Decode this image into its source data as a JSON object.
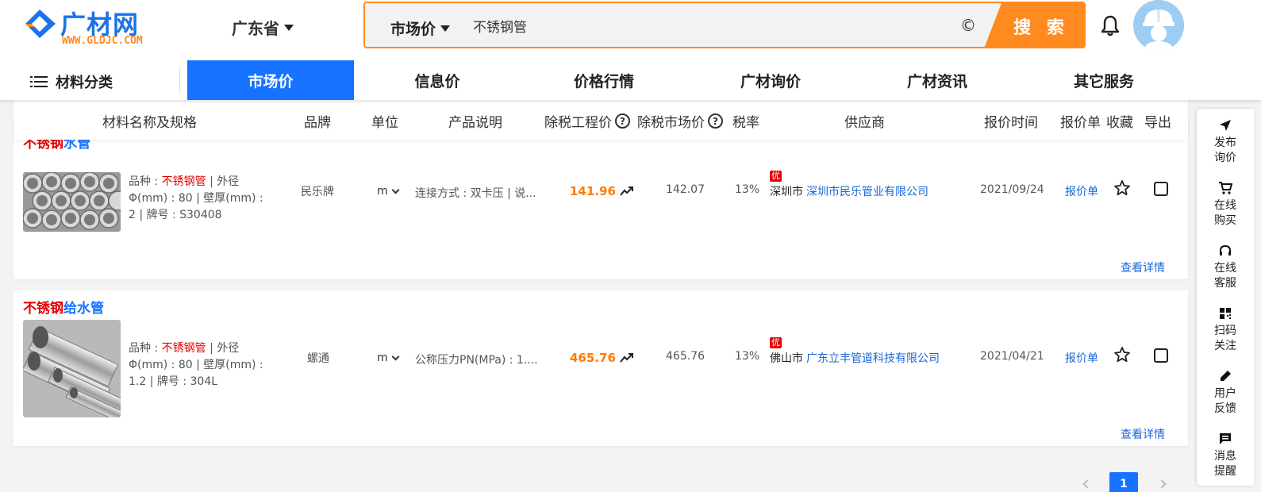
{
  "header": {
    "logo_title": "广材网",
    "logo_sub": "WWW.GLDJC.COM",
    "province": "广东省",
    "search": {
      "type": "市场价",
      "value": "不锈钢管",
      "button": "搜 索",
      "icon": "copyright-icon"
    }
  },
  "nav": {
    "category_label": "材料分类",
    "items": [
      {
        "label": "市场价",
        "active": true
      },
      {
        "label": "信息价",
        "active": false
      },
      {
        "label": "价格行情",
        "active": false
      },
      {
        "label": "广材询价",
        "active": false
      },
      {
        "label": "广材资讯",
        "active": false
      },
      {
        "label": "其它服务",
        "active": false
      }
    ]
  },
  "table_header": {
    "name": "材料名称及规格",
    "brand": "品牌",
    "unit": "单位",
    "desc": "产品说明",
    "eng_price": "除税工程价",
    "market_price": "除税市场价",
    "tax": "税率",
    "supplier": "供应商",
    "time": "报价时间",
    "quote": "报价单",
    "fav": "收藏",
    "export": "导出"
  },
  "rows": [
    {
      "title_red": "不锈钢",
      "title_blue": "水管",
      "spec_prefix": "品种 : ",
      "spec_kw": "不锈钢管",
      "spec_rest": " | 外径Φ(mm) : 80 | 壁厚(mm) : 2 | 牌号 : S30408",
      "brand": "民乐牌",
      "unit": "m",
      "desc": "连接方式 : 双卡压 | 说...",
      "eng_price": "141.96",
      "market_price": "142.07",
      "tax": "13%",
      "badge": "优",
      "city": "深圳市",
      "supplier": "深圳市民乐管业有限公司",
      "time": "2021/09/24",
      "quote": "报价单",
      "detail": "查看详情"
    },
    {
      "title_red": "不锈钢",
      "title_blue": "给水管",
      "spec_prefix": "品种 : ",
      "spec_kw": "不锈钢管",
      "spec_rest": " | 外径Φ(mm) : 80 | 壁厚(mm) : 1.2 | 牌号 : 304L",
      "brand": "螺通",
      "unit": "m",
      "desc": "公称压力PN(MPa) : 1....",
      "eng_price": "465.76",
      "market_price": "465.76",
      "tax": "13%",
      "badge": "优",
      "city": "佛山市",
      "supplier": "广东立丰管道科技有限公司",
      "time": "2021/04/21",
      "quote": "报价单",
      "detail": "查看详情"
    }
  ],
  "sidebar": [
    {
      "label": "发布询价",
      "icon": "send-icon"
    },
    {
      "label": "在线购买",
      "icon": "cart-icon"
    },
    {
      "label": "在线客服",
      "icon": "headset-icon"
    },
    {
      "label": "扫码关注",
      "icon": "qrcode-icon"
    },
    {
      "label": "用户反馈",
      "icon": "pen-icon"
    },
    {
      "label": "消息提醒",
      "icon": "message-icon"
    }
  ],
  "pagination": {
    "current": "1"
  },
  "colors": {
    "brand_blue": "#1673ff",
    "accent_orange": "#ff8a1f",
    "red": "#e60000"
  }
}
